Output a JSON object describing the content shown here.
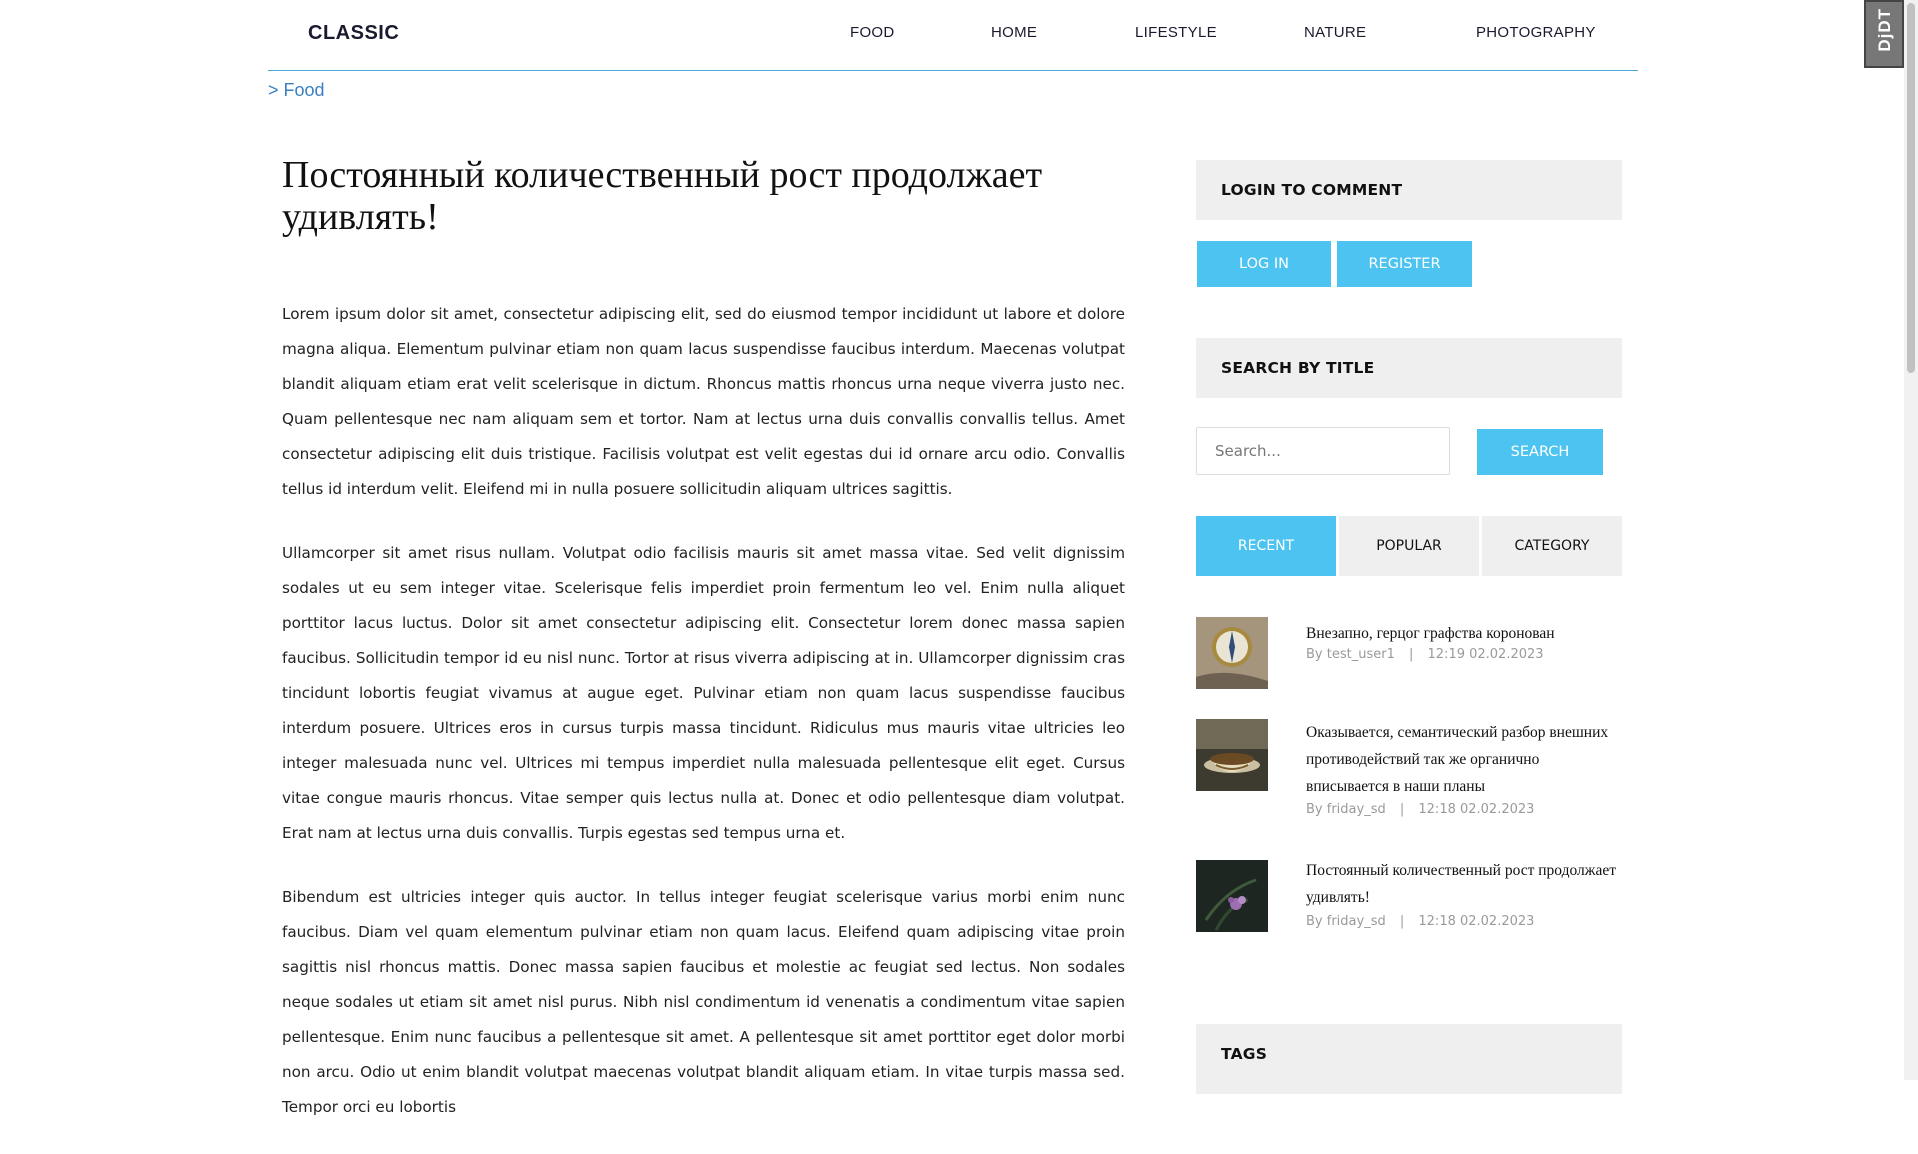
{
  "header": {
    "logo": "CLASSIC",
    "nav": [
      {
        "label": "FOOD"
      },
      {
        "label": "HOME"
      },
      {
        "label": "LIFESTYLE"
      },
      {
        "label": "NATURE"
      },
      {
        "label": "PHOTOGRAPHY"
      }
    ]
  },
  "breadcrumb": "> Food",
  "article": {
    "title": "Постоянный количественный рост продолжает удивлять!",
    "paragraphs": [
      "Lorem ipsum dolor sit amet, consectetur adipiscing elit, sed do eiusmod tempor incididunt ut labore et dolore magna aliqua. Elementum pulvinar etiam non quam lacus suspendisse faucibus interdum. Maecenas volutpat blandit aliquam etiam erat velit scelerisque in dictum. Rhoncus mattis rhoncus urna neque viverra justo nec. Quam pellentesque nec nam aliquam sem et tortor. Nam at lectus urna duis convallis convallis tellus. Amet consectetur adipiscing elit duis tristique. Facilisis volutpat est velit egestas dui id ornare arcu odio. Convallis tellus id interdum velit. Eleifend mi in nulla posuere sollicitudin aliquam ultrices sagittis.",
      "Ullamcorper sit amet risus nullam. Volutpat odio facilisis mauris sit amet massa vitae. Sed velit dignissim sodales ut eu sem integer vitae. Scelerisque felis imperdiet proin fermentum leo vel. Enim nulla aliquet porttitor lacus luctus. Dolor sit amet consectetur adipiscing elit. Consectetur lorem donec massa sapien faucibus. Sollicitudin tempor id eu nisl nunc. Tortor at risus viverra adipiscing at in. Ullamcorper dignissim cras tincidunt lobortis feugiat vivamus at augue eget. Pulvinar etiam non quam lacus suspendisse faucibus interdum posuere. Ultrices eros in cursus turpis massa tincidunt. Ridiculus mus mauris vitae ultricies leo integer malesuada nunc vel. Ultrices mi tempus imperdiet nulla malesuada pellentesque elit eget. Cursus vitae congue mauris rhoncus. Vitae semper quis lectus nulla at. Donec et odio pellentesque diam volutpat. Erat nam at lectus urna duis convallis. Turpis egestas sed tempus urna et.",
      "Bibendum est ultricies integer quis auctor. In tellus integer feugiat scelerisque varius morbi enim nunc faucibus. Diam vel quam elementum pulvinar etiam non quam lacus. Eleifend quam adipiscing vitae proin sagittis nisl rhoncus mattis. Donec massa sapien faucibus et molestie ac feugiat sed lectus. Non sodales neque sodales ut etiam sit amet nisl purus. Nibh nisl condimentum id venenatis a condimentum vitae sapien pellentesque. Enim nunc faucibus a pellentesque sit amet. A pellentesque sit amet porttitor eget dolor morbi non arcu. Odio ut enim blandit volutpat maecenas volutpat blandit aliquam etiam. In vitae turpis massa sed. Tempor orci eu lobortis"
    ]
  },
  "sidebar": {
    "login_heading": "LOGIN TO COMMENT",
    "login_button": "LOG IN",
    "register_button": "REGISTER",
    "search_heading": "SEARCH BY TITLE",
    "search_placeholder": "Search...",
    "search_button": "SEARCH",
    "tabs": [
      {
        "label": "RECENT",
        "active": true
      },
      {
        "label": "POPULAR",
        "active": false
      },
      {
        "label": "CATEGORY",
        "active": false
      }
    ],
    "posts": [
      {
        "title": "Внезапно, герцог графства коронован",
        "author": "By test_user1",
        "sep": "|",
        "time": "12:19 02.02.2023",
        "thumb_icon": "compass-icon"
      },
      {
        "title": "Оказывается, семантический разбор внешних противодействий так же органично вписывается в наши планы",
        "author": "By friday_sd",
        "sep": "|",
        "time": "12:18 02.02.2023",
        "thumb_icon": "tea-cup-icon"
      },
      {
        "title": "Постоянный количественный рост продолжает удивлять!",
        "author": "By friday_sd",
        "sep": "|",
        "time": "12:18 02.02.2023",
        "thumb_icon": "flower-icon"
      }
    ],
    "tags_heading": "TAGS"
  },
  "debug_toolbar": "DjDT",
  "colors": {
    "accent": "#4cc3f0",
    "breadcrumb": "#3a7fc1",
    "header_rule": "#4aa9d8",
    "panel_bg": "#efefef"
  }
}
